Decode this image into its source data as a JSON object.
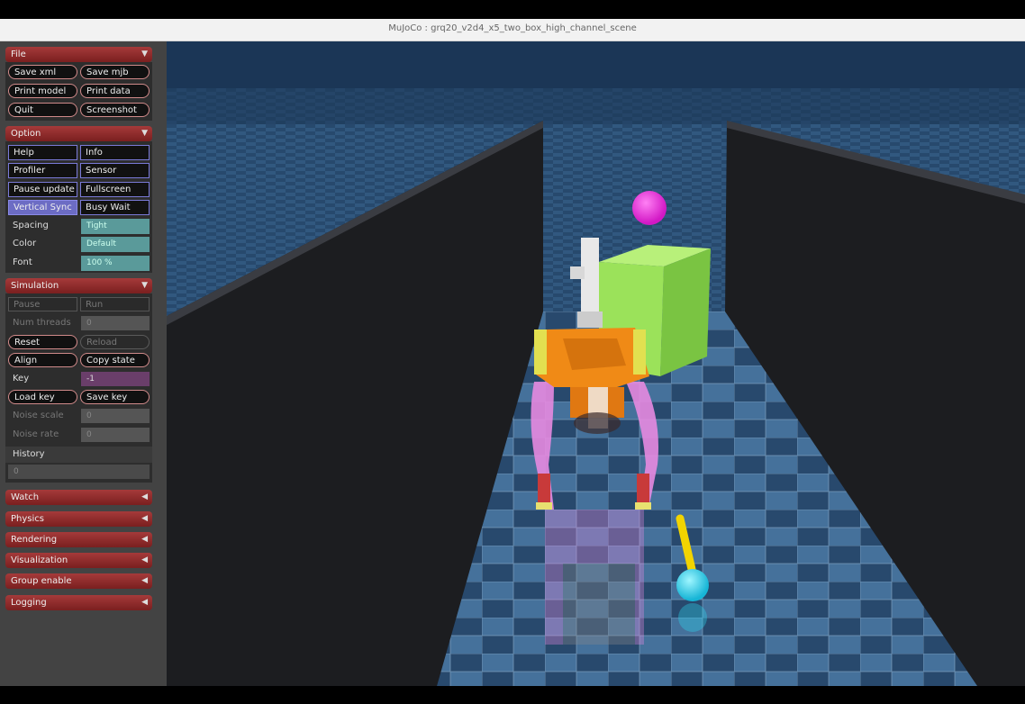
{
  "window": {
    "title": "MuJoCo : grq20_v2d4_x5_two_box_high_channel_scene"
  },
  "file": {
    "header": "File",
    "arrow": "▼",
    "buttons": [
      "Save xml",
      "Save mjb",
      "Print model",
      "Print data",
      "Quit",
      "Screenshot"
    ]
  },
  "option": {
    "header": "Option",
    "arrow": "▼",
    "toggles": [
      "Help",
      "Info",
      "Profiler",
      "Sensor",
      "Pause update",
      "Fullscreen",
      "Vertical Sync",
      "Busy Wait"
    ],
    "spacing_label": "Spacing",
    "spacing_value": "Tight",
    "color_label": "Color",
    "color_value": "Default",
    "font_label": "Font",
    "font_value": "100 %"
  },
  "simulation": {
    "header": "Simulation",
    "arrow": "▼",
    "pause": "Pause",
    "run": "Run",
    "num_threads_label": "Num threads",
    "num_threads_value": "0",
    "reset": "Reset",
    "reload": "Reload",
    "align": "Align",
    "copy_state": "Copy state",
    "key_label": "Key",
    "key_value": "-1",
    "load_key": "Load key",
    "save_key": "Save key",
    "noise_scale_label": "Noise scale",
    "noise_scale_value": "0",
    "noise_rate_label": "Noise rate",
    "noise_rate_value": "0",
    "history_label": "History",
    "history_value": "0"
  },
  "collapsed": {
    "arrow": "◀",
    "sections": [
      "Watch",
      "Physics",
      "Rendering",
      "Visualization",
      "Group enable",
      "Logging"
    ]
  },
  "colors": {
    "section_header": "#8a2a2a",
    "toggle_on": "#6c6cc4",
    "select_bg": "#5a9a9a",
    "key_field": "#6a3e6a",
    "floor_tile_light": "#4d7ba6",
    "floor_tile_dark": "#2b4c70",
    "wall": "#1c1d20",
    "box": "#9be25a",
    "target_sphere": "#e630d8",
    "robot_body": "#f08a16",
    "robot_legs": "#e58ae0",
    "stick": "#f2d400",
    "stick_ball": "#2cd9f0"
  }
}
